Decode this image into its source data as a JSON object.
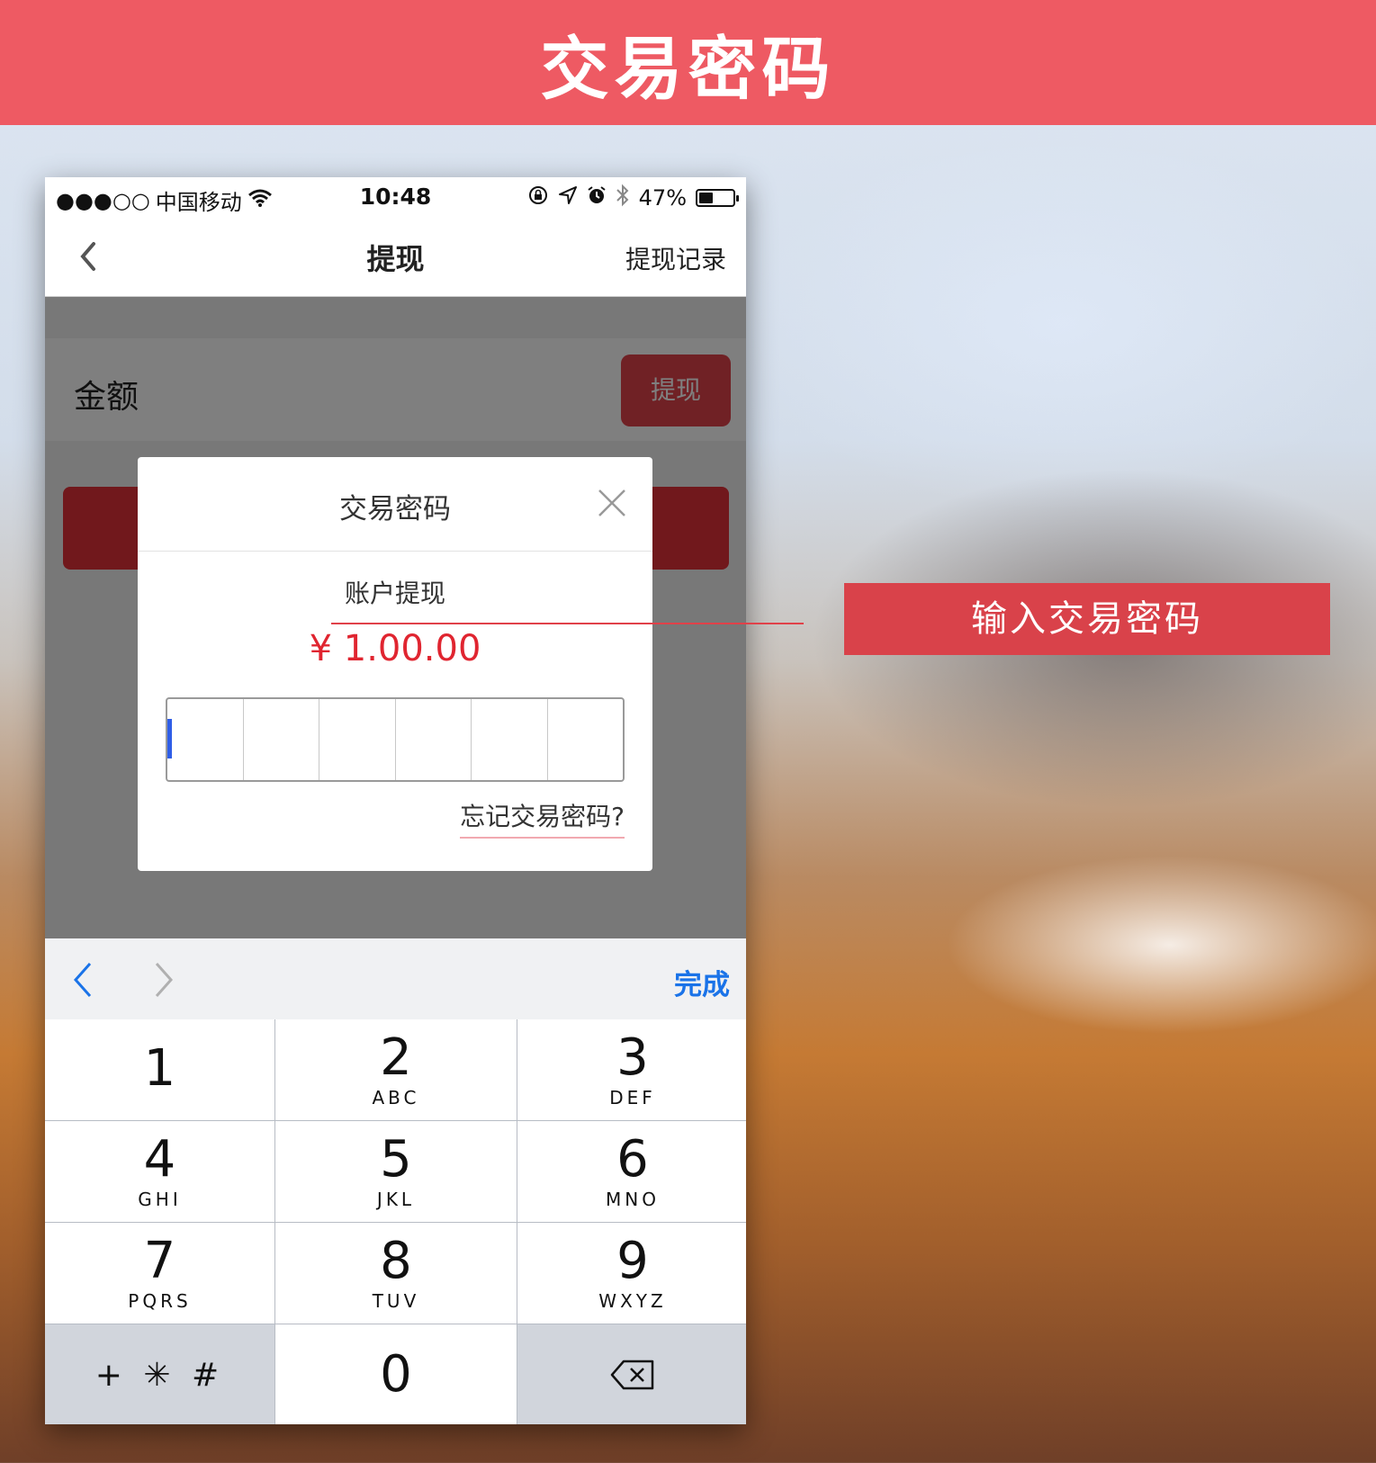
{
  "banner": {
    "title": "交易密码"
  },
  "status_bar": {
    "signal": "●●●○○",
    "carrier": "中国移动",
    "time": "10:48",
    "battery_percent": "47%",
    "battery_level": 0.47
  },
  "navbar": {
    "title": "提现",
    "right_label": "提现记录"
  },
  "page": {
    "amount_label": "金额",
    "withdraw_button": "提现"
  },
  "modal": {
    "title": "交易密码",
    "subtitle": "账户提现",
    "amount": "¥ 1.00.00",
    "forgot_link": "忘记交易密码?",
    "digits": 6,
    "entered": 0
  },
  "keyboard": {
    "done_label": "完成",
    "keys": [
      {
        "num": "1",
        "letters": ""
      },
      {
        "num": "2",
        "letters": "ABC"
      },
      {
        "num": "3",
        "letters": "DEF"
      },
      {
        "num": "4",
        "letters": "GHI"
      },
      {
        "num": "5",
        "letters": "JKL"
      },
      {
        "num": "6",
        "letters": "MNO"
      },
      {
        "num": "7",
        "letters": "PQRS"
      },
      {
        "num": "8",
        "letters": "TUV"
      },
      {
        "num": "9",
        "letters": "WXYZ"
      }
    ],
    "symbols_key": "+ ✳ #",
    "zero_key": "0"
  },
  "callout": {
    "label": "输入交易密码"
  },
  "colors": {
    "banner": "#ee5a63",
    "accent_red": "#e02530",
    "cursor_blue": "#2f5ee7",
    "link_blue": "#1a73e8"
  }
}
